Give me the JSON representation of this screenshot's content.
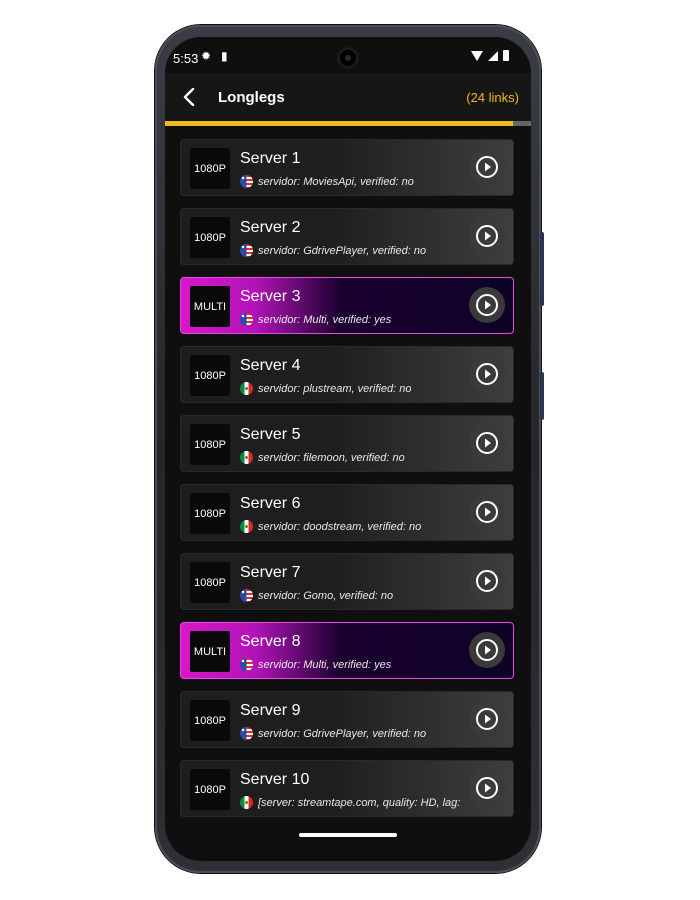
{
  "status_bar": {
    "time": "5:53"
  },
  "toolbar": {
    "title": "Longlegs",
    "links_count": "(24 links)"
  },
  "progress": {
    "fraction": 0.95
  },
  "colors": {
    "accent": "#f0b91c",
    "multi_highlight": "#d816c8"
  },
  "servers": [
    {
      "quality": "1080P",
      "name": "Server 1",
      "flag": "us-flag-icon",
      "meta": "servidor: MoviesApi, verified: no",
      "multi": false
    },
    {
      "quality": "1080P",
      "name": "Server 2",
      "flag": "us-flag-icon",
      "meta": "servidor: GdrivePlayer, verified: no",
      "multi": false
    },
    {
      "quality": "MULTI",
      "name": "Server 3",
      "flag": "us-flag-icon",
      "meta": "servidor: Multi, verified: yes",
      "multi": true
    },
    {
      "quality": "1080P",
      "name": "Server 4",
      "flag": "mx-flag-icon",
      "meta": "servidor: plustream, verified: no",
      "multi": false
    },
    {
      "quality": "1080P",
      "name": "Server 5",
      "flag": "mx-flag-icon",
      "meta": "servidor: filemoon, verified: no",
      "multi": false
    },
    {
      "quality": "1080P",
      "name": "Server 6",
      "flag": "mx-flag-icon",
      "meta": "servidor: doodstream, verified: no",
      "multi": false
    },
    {
      "quality": "1080P",
      "name": "Server 7",
      "flag": "us-flag-icon",
      "meta": "servidor: Gomo, verified: no",
      "multi": false
    },
    {
      "quality": "MULTI",
      "name": "Server 8",
      "flag": "us-flag-icon",
      "meta": "servidor: Multi, verified: yes",
      "multi": true
    },
    {
      "quality": "1080P",
      "name": "Server 9",
      "flag": "us-flag-icon",
      "meta": "servidor: GdrivePlayer, verified: no",
      "multi": false
    },
    {
      "quality": "1080P",
      "name": "Server 10",
      "flag": "mx-flag-icon",
      "meta": "[server: streamtape.com, quality: HD, lag:",
      "multi": false
    }
  ]
}
